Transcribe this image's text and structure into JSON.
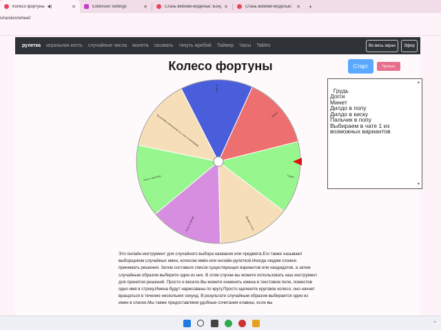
{
  "browser": {
    "tabs": [
      {
        "title": "Колесо фортуны",
        "active": true,
        "audio": "◀)",
        "fav_color": "#e8455c"
      },
      {
        "title": "Extension Settings",
        "active": false,
        "fav_color": "#c53cc9"
      },
      {
        "title": "Стань веб̆ими-моделью: Бонус",
        "active": false,
        "fav_color": "#e8455c"
      },
      {
        "title": "Стань веб̆ими-моделью: Бонус",
        "active": false,
        "fav_color": "#e8455c"
      }
    ],
    "new_tab": "+",
    "address": "n/random/wheel/"
  },
  "nav": {
    "brand": "рулетка",
    "items": [
      "игральная кость",
      "случайные числа",
      "монета",
      "гасовать",
      "тянуть жребий",
      "Таймер",
      "Часы",
      "Tables"
    ],
    "fullscreen_label": "Во весь экран",
    "live_label": "Эфир"
  },
  "main": {
    "title": "Колесо фортуны",
    "start_label": "Старт",
    "skip_label": "Пропуск",
    "names_text": "Грудь\nДогги\nМинет\nДилдо в попу\nДилдо в киску\nПальчик в попу\nВыбираем в чате 1 из\nвозможных вариантов"
  },
  "wheel": {
    "segments": [
      {
        "label": "Догги",
        "color": "#4a5edb"
      },
      {
        "label": "Минет",
        "color": "#ee6f6f"
      },
      {
        "label": "Грудь",
        "color": "#98f68e"
      },
      {
        "label": "Дилдо в попу",
        "color": "#f6dfb8"
      },
      {
        "label": "Дилдо в киску",
        "color": "#d88ee0"
      },
      {
        "label": "Пальчик в попу",
        "color": "#98f68e"
      },
      {
        "label": "Выбираем в чате 1 из возможных вариантов",
        "color": "#f6dfb8"
      }
    ],
    "pointer_color": "#e01010"
  },
  "description": "Это онлайн-инструмент для случайного выбора названия или предмета.Его также называют выборщиком случайных имен, колесом имён или онлайн-рулеткой.Иногда людям сложно принимать решения. Затем составьте список существующих вариантов или кандидатов, а затем случайным образом выберите один из них. В этом случае вы можете использовать наш инструмент для принятия решений. Просто и весело.Вы можете изменить имена в текстовом поле, поместив одно имя в строку.Имена будут нарисованы по кругу.Просто щелкните круговое колесо, оно начнет вращаться в течение нескольких секунд. В результате случайным образом выбирается один из имен в списке.Мы также предоставляем удобные сочетания клавиш, если вы"
}
